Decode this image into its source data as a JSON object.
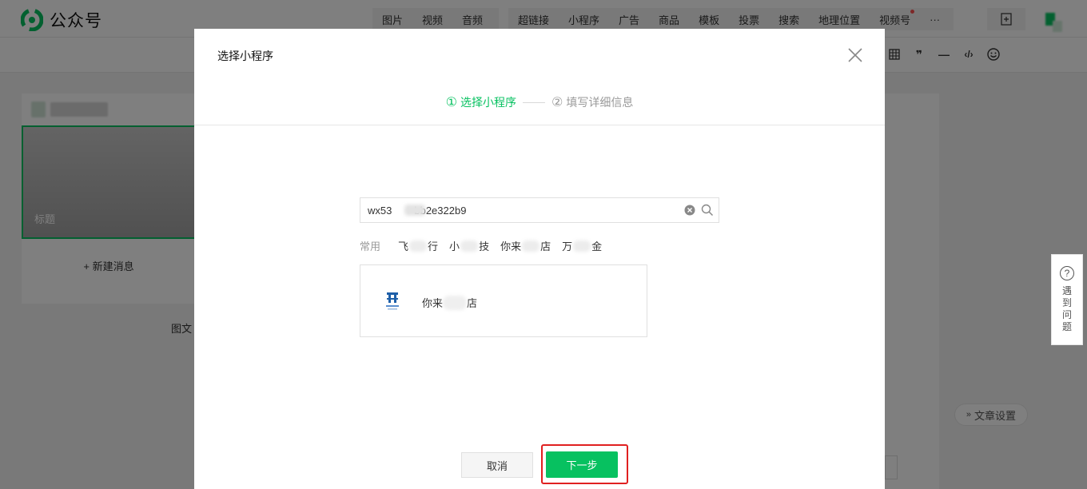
{
  "app": {
    "name": "公众号",
    "insert_menu_group1": [
      "图片",
      "视频",
      "音频"
    ],
    "insert_menu_group2": [
      "超链接",
      "小程序",
      "广告",
      "商品",
      "模板",
      "投票",
      "搜索",
      "地理位置",
      "视频号",
      "···"
    ],
    "colors": {
      "accent": "#07c160",
      "highlight": "#e02020",
      "dot": "#fa5151"
    }
  },
  "editor": {
    "cover_title_placeholder": "标题",
    "new_message": "+ 新建消息",
    "left_caption": "图文",
    "article_settings": "文章设置",
    "help": "遇到问题"
  },
  "dialog": {
    "title": "选择小程序",
    "steps": [
      {
        "num": "①",
        "label": "选择小程序",
        "state": "active"
      },
      {
        "num": "②",
        "label": "填写详细信息",
        "state": "inactive"
      }
    ],
    "search": {
      "value_prefix": "wx53",
      "value_suffix": "bb2e322b9"
    },
    "common": {
      "label": "常用",
      "items": [
        {
          "a": "飞",
          "b": "行"
        },
        {
          "a": "小",
          "b": "技"
        },
        {
          "a": "你来",
          "b": "店"
        },
        {
          "a": "万",
          "b": "金"
        }
      ]
    },
    "result": {
      "name_prefix": "你来",
      "name_suffix": "店"
    },
    "buttons": {
      "cancel": "取消",
      "next": "下一步"
    }
  }
}
